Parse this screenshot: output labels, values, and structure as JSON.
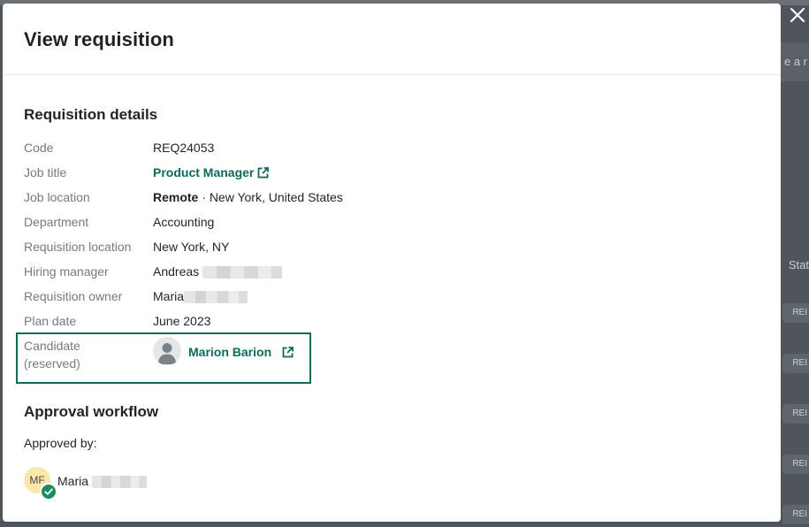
{
  "modal": {
    "title": "View requisition"
  },
  "details": {
    "section_title": "Requisition details",
    "rows": [
      {
        "label": "Code",
        "value": "REQ24053"
      },
      {
        "label": "Job title",
        "value": "Product Manager"
      },
      {
        "label": "Job location",
        "value_bold": "Remote",
        "separator": " · ",
        "value": "New York, United States"
      },
      {
        "label": "Department",
        "value": "Accounting"
      },
      {
        "label": "Requisition location",
        "value": "New York, NY"
      },
      {
        "label": "Hiring manager",
        "value": "Andreas"
      },
      {
        "label": "Requisition owner",
        "value": "Maria"
      },
      {
        "label": "Plan date",
        "value": "June 2023"
      }
    ],
    "candidate": {
      "label_line1": "Candidate",
      "label_line2": "(reserved)",
      "name": "Marion Barion"
    }
  },
  "approval": {
    "section_title": "Approval workflow",
    "approved_by_label": "Approved by:",
    "approver": {
      "initials": "MF",
      "name": "Maria",
      "status": "approved"
    }
  },
  "background": {
    "partial_text": "e a r",
    "partial_status": "Stat",
    "pill_text": "REI"
  },
  "colors": {
    "link": "#0c6b58",
    "highlight_border": "#0c6b58",
    "approved_badge": "#1f8a5e",
    "avatar_bg": "#fbe7a8"
  },
  "icons": {
    "close": "close-icon",
    "external_link": "external-link-icon",
    "avatar_placeholder": "user-silhouette-icon",
    "approved": "check-circle-icon"
  }
}
